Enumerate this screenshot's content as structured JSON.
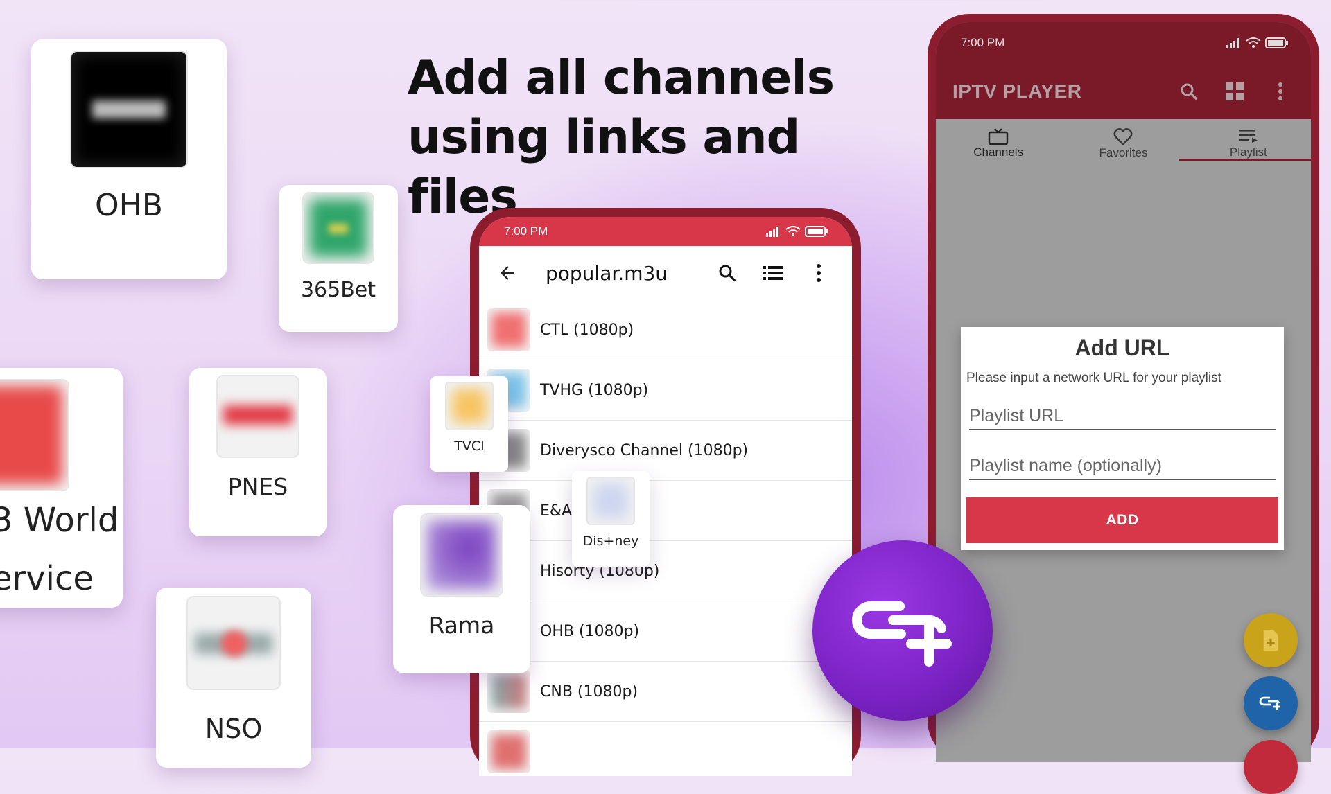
{
  "headline": {
    "line1": "Add all channels",
    "line2": "using links and files"
  },
  "cards": [
    {
      "name": "OHB",
      "color": "#111111"
    },
    {
      "name": "365Bet",
      "color": "#3aa66a"
    },
    {
      "name": "3 World",
      "name2": "ervice",
      "color": "#e03a3a"
    },
    {
      "name": "PNES",
      "color": "#e0303a"
    },
    {
      "name": "NSO",
      "color": "#e04444"
    },
    {
      "name": "TVCI",
      "color": "#f5c060"
    },
    {
      "name": "Rama",
      "color": "#8a55c8"
    },
    {
      "name": "Dis+ney",
      "color": "#c8d4f0"
    }
  ],
  "phone_mid": {
    "time": "7:00 PM",
    "title": "popular.m3u",
    "channels": [
      {
        "label": "CTL (1080p)",
        "color": "#f07070"
      },
      {
        "label": "TVHG (1080p)",
        "color": "#7fc6ea"
      },
      {
        "label": "Diverysco Channel (1080p)",
        "color": "#888888"
      },
      {
        "label": "E&A",
        "color": "#999999"
      },
      {
        "label": "Hisorty (1080p)",
        "color": "#aaaaaa"
      },
      {
        "label": "OHB (1080p)",
        "color": "#bbbbbb"
      },
      {
        "label": "CNB (1080p)",
        "color": "#7a9ab5"
      },
      {
        "label": "",
        "color": "#e07070"
      }
    ]
  },
  "phone_right": {
    "time": "7:00 PM",
    "app_title": "IPTV PLAYER",
    "tabs": [
      {
        "label": "Channels",
        "icon": "tv-icon"
      },
      {
        "label": "Favorites",
        "icon": "heart-icon"
      },
      {
        "label": "Playlist",
        "icon": "playlist-icon"
      }
    ],
    "dialog": {
      "title": "Add URL",
      "subtitle": "Please input a network URL for your playlist",
      "url_placeholder": "Playlist URL",
      "name_placeholder": "Playlist name (optionally)",
      "add_label": "ADD"
    }
  },
  "colors": {
    "accent_red": "#d8374a",
    "phone_frame": "#8c1d2f",
    "fab_purple": "#7a22c4",
    "fab_yellow": "#c9a319",
    "fab_blue": "#1f64a8"
  }
}
